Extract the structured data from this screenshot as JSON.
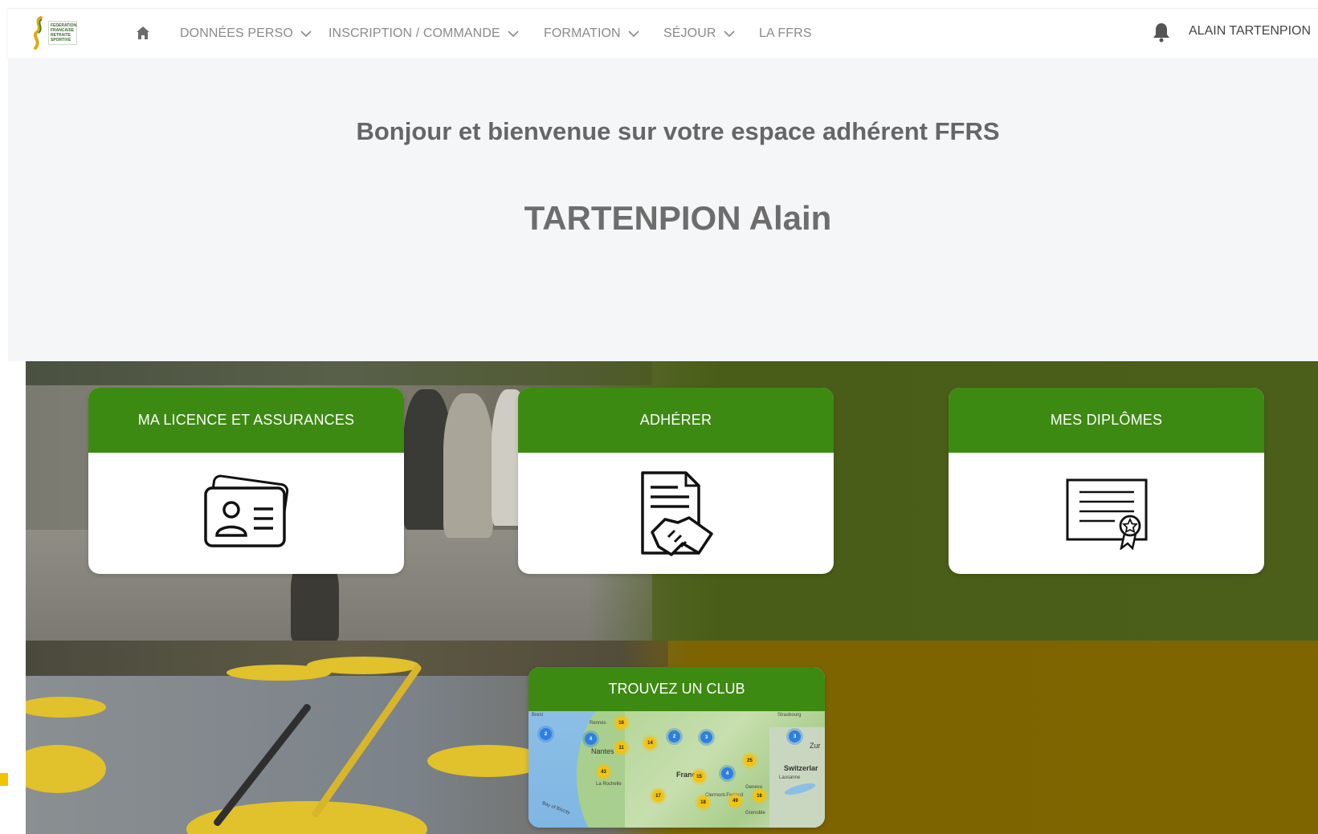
{
  "nav": {
    "logo_text": "FEDERATION FRANCAISE RETRAITE SPORTIVE",
    "items": [
      {
        "label": "DONNÉES PERSO",
        "has_dropdown": true
      },
      {
        "label": "INSCRIPTION / COMMANDE",
        "has_dropdown": true
      },
      {
        "label": "FORMATION",
        "has_dropdown": true
      },
      {
        "label": "SÉJOUR",
        "has_dropdown": true
      },
      {
        "label": "LA FFRS",
        "has_dropdown": false
      }
    ],
    "user_label": "ALAIN TARTENPION"
  },
  "hero": {
    "greeting": "Bonjour et bienvenue sur votre espace adhérent FFRS",
    "user_name": "TARTENPION Alain"
  },
  "cards": [
    {
      "title": "MA LICENCE ET ASSURANCES",
      "icon": "id-card-icon"
    },
    {
      "title": "ADHÉRER",
      "icon": "contract-handshake-icon"
    },
    {
      "title": "MES DIPLÔMES",
      "icon": "diploma-certificate-icon"
    }
  ],
  "club_card": {
    "title": "TROUVEZ UN CLUB",
    "map_labels": {
      "nantes": "Nantes",
      "rennes": "Rennes",
      "brest": "Brest",
      "france": "Franc",
      "switzerland": "Switzerlar",
      "geneva": "Geneva",
      "la_rochelle": "La Rochelle",
      "clermont": "Clermont-Ferrand",
      "grenoble": "Grenoble",
      "zurich": "Zur",
      "lausanne": "Lausanne",
      "strasbourg": "Strasbourg",
      "bay": "Bay of Biscay"
    },
    "markers": [
      {
        "value": "16",
        "color": "yellow"
      },
      {
        "value": "11",
        "color": "yellow"
      },
      {
        "value": "14",
        "color": "yellow"
      },
      {
        "value": "43",
        "color": "yellow"
      },
      {
        "value": "15",
        "color": "yellow"
      },
      {
        "value": "25",
        "color": "yellow"
      },
      {
        "value": "17",
        "color": "yellow"
      },
      {
        "value": "18",
        "color": "yellow"
      },
      {
        "value": "49",
        "color": "yellow"
      },
      {
        "value": "16",
        "color": "yellow"
      },
      {
        "value": "2",
        "color": "blue"
      },
      {
        "value": "4",
        "color": "blue"
      },
      {
        "value": "2",
        "color": "blue"
      },
      {
        "value": "3",
        "color": "blue"
      },
      {
        "value": "4",
        "color": "blue"
      },
      {
        "value": "3",
        "color": "blue"
      }
    ]
  },
  "colors": {
    "card_header_green": "#3d8a12",
    "band_green": "#4b5e1a",
    "band_ochre": "#7f6500",
    "hero_background": "#f5f6f8"
  }
}
